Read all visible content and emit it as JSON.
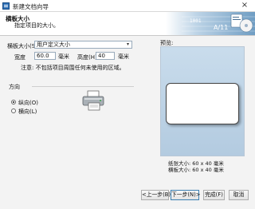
{
  "window": {
    "title": "新建文档向导",
    "close_label": "×"
  },
  "header": {
    "title": "横板大小",
    "subtitle": "指定项目的大小。",
    "decor_text": [
      "1001",
      "A/11"
    ]
  },
  "size_form": {
    "size_label": "横板大小(S):",
    "size_value": "用户定义大小",
    "width_label": "宽度",
    "width_value": "60.0",
    "width_unit": "毫米",
    "height_label": "高度(H):",
    "height_value": "40",
    "height_unit": "毫米",
    "note": "注意: 不包括项目周围任何未使用的区域。"
  },
  "orientation": {
    "title": "方向",
    "portrait_label": "纵向(O)",
    "landscape_label": "横向(L)",
    "selected": "portrait"
  },
  "preview": {
    "label": "预览:",
    "paper_size": "纸张大小: 60 x 40 毫米",
    "board_size": "横板大小: 60 x 40 毫米"
  },
  "buttons": {
    "back": "<上一步(B)",
    "next": "下一步(N)>",
    "finish": "完成(F)",
    "cancel": "取消"
  }
}
